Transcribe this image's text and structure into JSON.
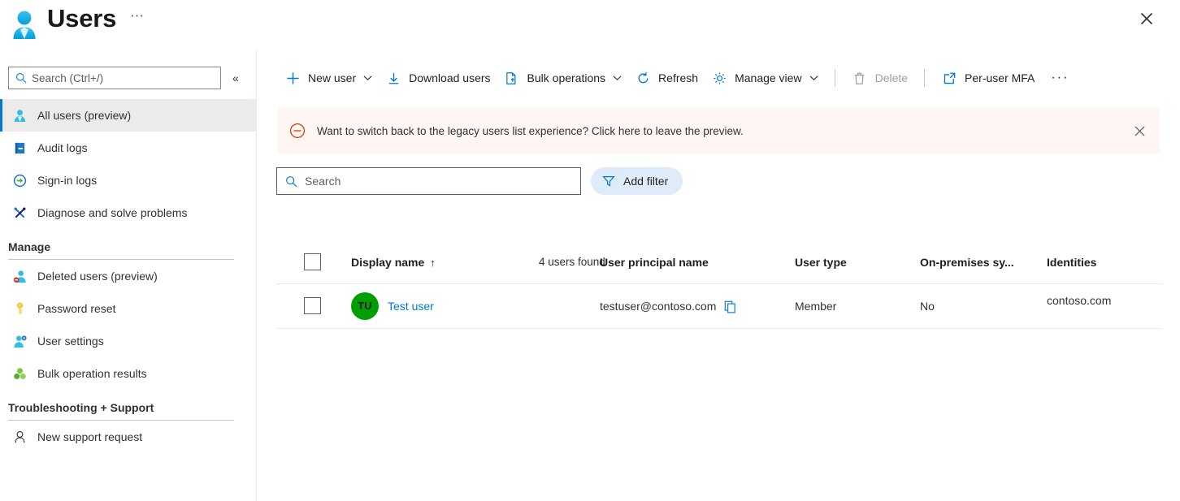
{
  "header": {
    "title": "Users",
    "ellipsis": "⋯",
    "icon": "user-avatar-icon",
    "close_label": "✕"
  },
  "sidebar": {
    "search": {
      "placeholder": "Search (Ctrl+/)",
      "value": ""
    },
    "collapse_label": "«",
    "items": [
      {
        "label": "All users (preview)",
        "icon": "user-icon",
        "selected": true
      },
      {
        "label": "Audit logs",
        "icon": "audit-log-icon",
        "selected": false
      },
      {
        "label": "Sign-in logs",
        "icon": "sign-in-icon",
        "selected": false
      },
      {
        "label": "Diagnose and solve problems",
        "icon": "wrench-screwdriver-icon",
        "selected": false
      }
    ],
    "manage_section": {
      "title": "Manage",
      "items": [
        {
          "label": "Deleted users (preview)",
          "icon": "deleted-user-icon"
        },
        {
          "label": "Password reset",
          "icon": "key-icon"
        },
        {
          "label": "User settings",
          "icon": "user-settings-icon"
        },
        {
          "label": "Bulk operation results",
          "icon": "bulk-results-icon"
        }
      ]
    },
    "support_section": {
      "title": "Troubleshooting + Support",
      "items": [
        {
          "label": "New support request",
          "icon": "support-person-icon"
        }
      ]
    }
  },
  "toolbar": {
    "new_user": {
      "label": "New user",
      "icon": "plus-icon",
      "caret": true
    },
    "download_users": {
      "label": "Download users",
      "icon": "download-icon",
      "caret": false
    },
    "bulk_operations": {
      "label": "Bulk operations",
      "icon": "bulk-file-icon",
      "caret": true
    },
    "refresh": {
      "label": "Refresh",
      "icon": "refresh-icon",
      "caret": false
    },
    "manage_view": {
      "label": "Manage view",
      "icon": "gear-icon",
      "caret": true
    },
    "delete": {
      "label": "Delete",
      "icon": "trash-icon",
      "caret": false,
      "disabled": true
    },
    "per_user_mfa": {
      "label": "Per-user MFA",
      "icon": "external-link-icon",
      "caret": false
    },
    "overflow_label": "···"
  },
  "banner": {
    "icon": "minus-circle-icon",
    "text": "Want to switch back to the legacy users list experience? Click here to leave the preview.",
    "close_label": "✕",
    "accent_color": "#d83b01",
    "background_color": "#fdf6f3"
  },
  "filters": {
    "search": {
      "placeholder": "Search",
      "value": "",
      "icon": "search-icon"
    },
    "add_filter": {
      "label": "Add filter",
      "icon": "filter-icon"
    }
  },
  "results": {
    "count_text": "4 users found"
  },
  "table": {
    "select_all_checkbox": "unchecked",
    "columns": [
      {
        "key": "display_name",
        "label": "Display name",
        "sorted": true,
        "sort_arrow": "↑"
      },
      {
        "key": "upn",
        "label": "User principal name",
        "sorted": false,
        "sort_arrow": ""
      },
      {
        "key": "user_type",
        "label": "User type",
        "sorted": false,
        "sort_arrow": ""
      },
      {
        "key": "on_premises",
        "label": "On-premises sy...",
        "sorted": false,
        "sort_arrow": ""
      },
      {
        "key": "identities",
        "label": "Identities",
        "sorted": false,
        "sort_arrow": ""
      }
    ],
    "rows": [
      {
        "checkbox": "unchecked",
        "avatar_initials": "TU",
        "avatar_color": "#009e00",
        "display_name": "Test user",
        "upn": "testuser@contoso.com",
        "copy_icon": "copy-icon",
        "user_type": "Member",
        "on_premises": "No",
        "identities": "contoso.com"
      }
    ]
  },
  "colors": {
    "accent": "#0078d4",
    "link": "#0078d4",
    "selected_nav_bg": "#edebe9",
    "filter_pill_bg": "#deecf9"
  }
}
